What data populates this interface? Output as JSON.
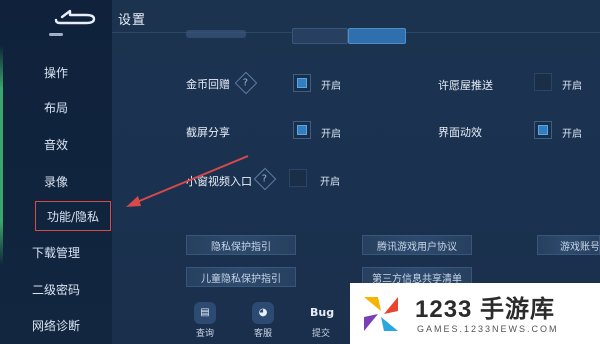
{
  "header": {
    "title": "设置"
  },
  "sidebar": {
    "items": [
      {
        "label": "操作"
      },
      {
        "label": "布局"
      },
      {
        "label": "音效"
      },
      {
        "label": "录像"
      },
      {
        "label": "功能/隐私"
      },
      {
        "label": "下载管理"
      },
      {
        "label": "二级密码"
      },
      {
        "label": "网络诊断"
      }
    ]
  },
  "settings": {
    "coin_reward": {
      "label": "金币回赠",
      "state": "开启"
    },
    "wish_push": {
      "label": "许愿屋推送",
      "state": "开启"
    },
    "screenshot_share": {
      "label": "截屏分享",
      "state": "开启"
    },
    "ui_animation": {
      "label": "界面动效",
      "state": "开启"
    },
    "mini_window": {
      "label": "小窗视频入口",
      "state": "开启"
    }
  },
  "links": {
    "privacy_guide": "隐私保护指引",
    "tencent_agreement": "腾讯游戏用户协议",
    "game_account": "游戏账号",
    "child_privacy": "儿童隐私保护指引",
    "third_party": "第三方信息共享清单"
  },
  "bottom_buttons": {
    "query": "查询",
    "service": "客服",
    "bug": "Bug",
    "submit": "提交"
  },
  "watermark": {
    "main": "1233 手游库",
    "sub": "GAMES.1233NEWS.COM"
  },
  "colors": {
    "accent": "#2f7fc2",
    "highlight": "#d84a4a",
    "sidebar_edge": "#3aa86a"
  }
}
